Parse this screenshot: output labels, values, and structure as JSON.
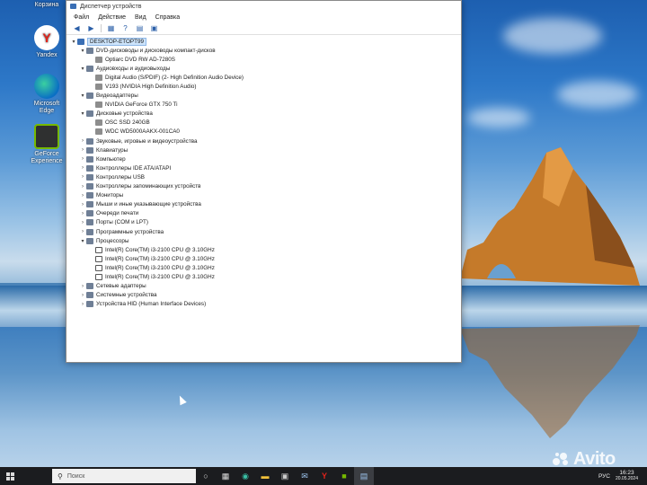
{
  "desktop": {
    "icons": [
      {
        "name": "recycle-bin",
        "label": "Корзина"
      },
      {
        "name": "yandex",
        "label": "Yandex"
      },
      {
        "name": "microsoft-edge",
        "label": "Microsoft Edge"
      },
      {
        "name": "geforce-experience",
        "label": "GeForce Experience"
      }
    ]
  },
  "window": {
    "title": "Диспетчер устройств",
    "menu": [
      "Файл",
      "Действие",
      "Вид",
      "Справка"
    ],
    "toolbar": [
      "back-icon",
      "forward-icon",
      "properties-icon",
      "help-icon",
      "update-icon",
      "monitor-icon"
    ],
    "tree": {
      "root": "DESKTOP-ETOPT99",
      "items": [
        {
          "label": "DVD-дисководы и дисководы компакт-дисков",
          "expanded": true,
          "children": [
            "Optiarc DVD RW AD-7280S"
          ]
        },
        {
          "label": "Аудиовходы и аудиовыходы",
          "expanded": true,
          "children": [
            "Digital Audio (S/PDIF) (2- High Definition Audio Device)",
            "V193 (NVIDIA High Definition Audio)"
          ]
        },
        {
          "label": "Видеоадаптеры",
          "expanded": true,
          "children": [
            "NVIDIA GeForce GTX 750 Ti"
          ]
        },
        {
          "label": "Дисковые устройства",
          "expanded": true,
          "children": [
            "OSC SSD 240GB",
            "WDC WD5000AAKX-001CA0"
          ]
        },
        {
          "label": "Звуковые, игровые и видеоустройства",
          "expanded": false,
          "children": []
        },
        {
          "label": "Клавиатуры",
          "expanded": false,
          "children": []
        },
        {
          "label": "Компьютер",
          "expanded": false,
          "children": []
        },
        {
          "label": "Контроллеры IDE ATA/ATAPI",
          "expanded": false,
          "children": []
        },
        {
          "label": "Контроллеры USB",
          "expanded": false,
          "children": []
        },
        {
          "label": "Контроллеры запоминающих устройств",
          "expanded": false,
          "children": []
        },
        {
          "label": "Мониторы",
          "expanded": false,
          "children": []
        },
        {
          "label": "Мыши и иные указывающие устройства",
          "expanded": false,
          "children": []
        },
        {
          "label": "Очереди печати",
          "expanded": false,
          "children": []
        },
        {
          "label": "Порты (COM и LPT)",
          "expanded": false,
          "children": []
        },
        {
          "label": "Программные устройства",
          "expanded": false,
          "children": []
        },
        {
          "label": "Процессоры",
          "expanded": true,
          "children": [
            "Intel(R) Core(TM) i3-2100 CPU @ 3.10GHz",
            "Intel(R) Core(TM) i3-2100 CPU @ 3.10GHz",
            "Intel(R) Core(TM) i3-2100 CPU @ 3.10GHz",
            "Intel(R) Core(TM) i3-2100 CPU @ 3.10GHz"
          ]
        },
        {
          "label": "Сетевые адаптеры",
          "expanded": false,
          "children": []
        },
        {
          "label": "Системные устройства",
          "expanded": false,
          "children": []
        },
        {
          "label": "Устройства HID (Human Interface Devices)",
          "expanded": false,
          "children": []
        }
      ]
    }
  },
  "taskbar": {
    "search_placeholder": "Поиск",
    "language": "РУС",
    "time": "16:23",
    "date": "20.05.2024"
  },
  "watermark": "Avito"
}
